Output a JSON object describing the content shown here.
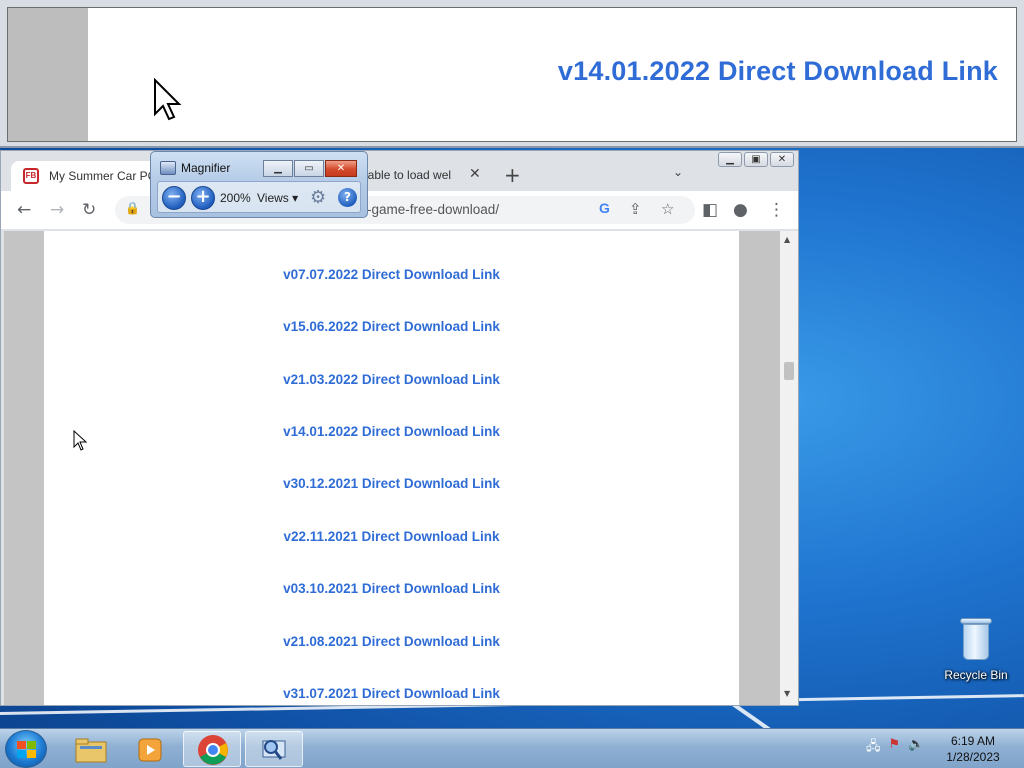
{
  "magnifier_lens": {
    "text": "v14.01.2022 Direct Download Link"
  },
  "browser": {
    "active_tab_title": "My Summer Car PC",
    "active_tab_favicon": "FB",
    "second_tab_title": "nable to load wel",
    "url": "-game-free-download/",
    "google_badge": "G",
    "links": [
      "v07.07.2022 Direct Download Link",
      "v15.06.2022 Direct Download Link",
      "v21.03.2022 Direct Download Link",
      "v14.01.2022 Direct Download Link",
      "v30.12.2021 Direct Download Link",
      "v22.11.2021 Direct Download Link",
      "v03.10.2021 Direct Download Link",
      "v21.08.2021 Direct Download Link",
      "v31.07.2021 Direct Download Link"
    ]
  },
  "magnifier_window": {
    "title": "Magnifier",
    "zoom": "200%",
    "views_label": "Views"
  },
  "desktop": {
    "recycle_bin_label": "Recycle Bin"
  },
  "taskbar": {
    "time": "6:19 AM",
    "date": "1/28/2023"
  },
  "colors": {
    "link": "#2f6cd6",
    "desktop": "#1f74cf"
  }
}
